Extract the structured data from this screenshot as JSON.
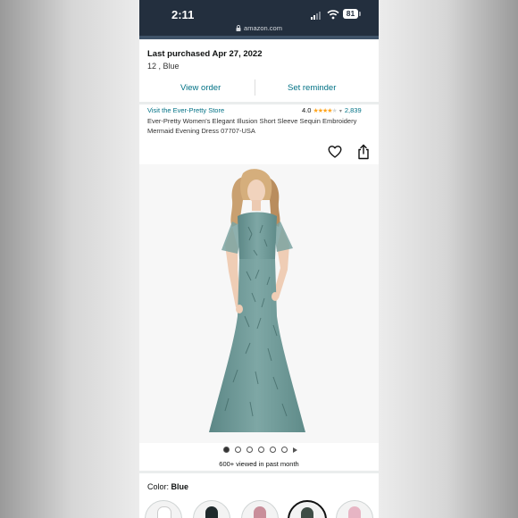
{
  "status_bar": {
    "time": "2:11",
    "battery": "81"
  },
  "browser": {
    "url": "amazon.com"
  },
  "purchase": {
    "title": "Last purchased Apr 27, 2022",
    "details": "12 , Blue",
    "view_order_label": "View order",
    "set_reminder_label": "Set reminder"
  },
  "product": {
    "store_link": "Visit the Ever-Pretty Store",
    "rating_value": "4.0",
    "rating_stars": 4,
    "rating_count": "2,839",
    "title": "Ever-Pretty Women's Elegant Illusion Short Sleeve Sequin Embroidery Mermaid Evening Dress 07707-USA"
  },
  "gallery": {
    "image_count": 6,
    "active_index": 0,
    "has_video": true,
    "viewed_text": "600+ viewed in past month"
  },
  "color": {
    "label": "Color:",
    "selected": "Blue",
    "swatch_colors": [
      "#ffffff",
      "#1f2a2c",
      "#c98e9a",
      "#3f4d46",
      "#e7b5c4"
    ],
    "selected_index": 3
  },
  "colors": {
    "header_bg": "#232f3e",
    "link": "#007185",
    "star": "#ffa41c",
    "dress": "#6f9a98"
  }
}
